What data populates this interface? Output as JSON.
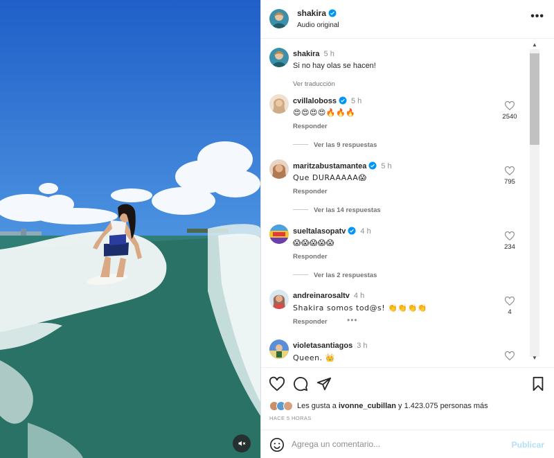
{
  "post": {
    "username": "shakira",
    "audio": "Audio original",
    "more_icon": "more-horizontal-icon"
  },
  "caption": {
    "username": "shakira",
    "time": "5 h",
    "text": "Si no hay olas se hacen!",
    "translate": "Ver traducción"
  },
  "comments": [
    {
      "username": "cvillaloboss",
      "time": "5 h",
      "text": "😍😍😍😍🔥🔥🔥",
      "reply": "Responder",
      "likes": "2540",
      "replies": "Ver las 9 respuestas",
      "avatar_color": "#c8a27a"
    },
    {
      "username": "maritzabustamantea",
      "time": "5 h",
      "text": "Que DURAAAAA😱",
      "reply": "Responder",
      "likes": "795",
      "replies": "Ver las 14 respuestas",
      "avatar_color": "#b07a54"
    },
    {
      "username": "sueltalasopatv",
      "time": "4 h",
      "text": "😱😱😱😱😱",
      "reply": "Responder",
      "likes": "234",
      "replies": "Ver las 2 respuestas",
      "avatar_color": "#f2c230"
    },
    {
      "username": "andreinarosaltv",
      "time": "4 h",
      "text": "Shakira somos tod@s! 👏👏👏👏",
      "reply": "Responder",
      "likes": "4",
      "more": "•••",
      "avatar_color": "#9a6a56"
    },
    {
      "username": "violetasantiagos",
      "time": "3 h",
      "text": "Queen. 👑",
      "avatar_color": "#5a8fd8"
    }
  ],
  "likes": {
    "prefix": "Les gusta a",
    "user": "ivonne_cubillan",
    "suffix": "y 1.423.075 personas más"
  },
  "time_ago": "HACE 5 HORAS",
  "composer": {
    "placeholder": "Agrega un comentario...",
    "publish": "Publicar"
  },
  "colors": {
    "verified": "#0095f6",
    "publish_disabled": "#b2dffc",
    "secondary_text": "#737373"
  }
}
